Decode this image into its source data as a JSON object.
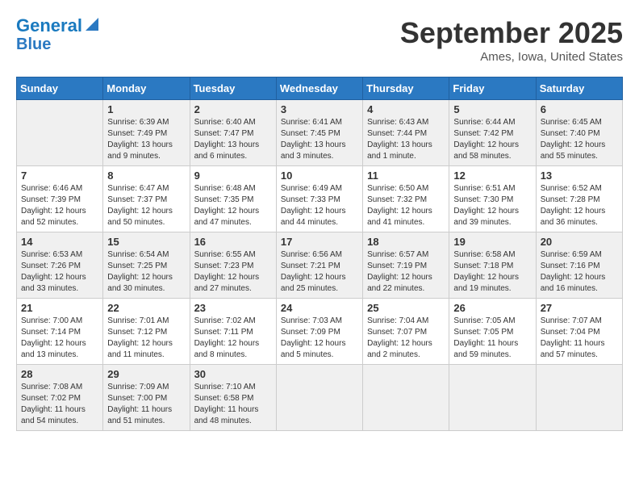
{
  "header": {
    "logo_line1": "General",
    "logo_line2": "Blue",
    "month_title": "September 2025",
    "location": "Ames, Iowa, United States"
  },
  "weekdays": [
    "Sunday",
    "Monday",
    "Tuesday",
    "Wednesday",
    "Thursday",
    "Friday",
    "Saturday"
  ],
  "weeks": [
    [
      {
        "day": "",
        "sunrise": "",
        "sunset": "",
        "daylight": ""
      },
      {
        "day": "1",
        "sunrise": "Sunrise: 6:39 AM",
        "sunset": "Sunset: 7:49 PM",
        "daylight": "Daylight: 13 hours and 9 minutes."
      },
      {
        "day": "2",
        "sunrise": "Sunrise: 6:40 AM",
        "sunset": "Sunset: 7:47 PM",
        "daylight": "Daylight: 13 hours and 6 minutes."
      },
      {
        "day": "3",
        "sunrise": "Sunrise: 6:41 AM",
        "sunset": "Sunset: 7:45 PM",
        "daylight": "Daylight: 13 hours and 3 minutes."
      },
      {
        "day": "4",
        "sunrise": "Sunrise: 6:43 AM",
        "sunset": "Sunset: 7:44 PM",
        "daylight": "Daylight: 13 hours and 1 minute."
      },
      {
        "day": "5",
        "sunrise": "Sunrise: 6:44 AM",
        "sunset": "Sunset: 7:42 PM",
        "daylight": "Daylight: 12 hours and 58 minutes."
      },
      {
        "day": "6",
        "sunrise": "Sunrise: 6:45 AM",
        "sunset": "Sunset: 7:40 PM",
        "daylight": "Daylight: 12 hours and 55 minutes."
      }
    ],
    [
      {
        "day": "7",
        "sunrise": "Sunrise: 6:46 AM",
        "sunset": "Sunset: 7:39 PM",
        "daylight": "Daylight: 12 hours and 52 minutes."
      },
      {
        "day": "8",
        "sunrise": "Sunrise: 6:47 AM",
        "sunset": "Sunset: 7:37 PM",
        "daylight": "Daylight: 12 hours and 50 minutes."
      },
      {
        "day": "9",
        "sunrise": "Sunrise: 6:48 AM",
        "sunset": "Sunset: 7:35 PM",
        "daylight": "Daylight: 12 hours and 47 minutes."
      },
      {
        "day": "10",
        "sunrise": "Sunrise: 6:49 AM",
        "sunset": "Sunset: 7:33 PM",
        "daylight": "Daylight: 12 hours and 44 minutes."
      },
      {
        "day": "11",
        "sunrise": "Sunrise: 6:50 AM",
        "sunset": "Sunset: 7:32 PM",
        "daylight": "Daylight: 12 hours and 41 minutes."
      },
      {
        "day": "12",
        "sunrise": "Sunrise: 6:51 AM",
        "sunset": "Sunset: 7:30 PM",
        "daylight": "Daylight: 12 hours and 39 minutes."
      },
      {
        "day": "13",
        "sunrise": "Sunrise: 6:52 AM",
        "sunset": "Sunset: 7:28 PM",
        "daylight": "Daylight: 12 hours and 36 minutes."
      }
    ],
    [
      {
        "day": "14",
        "sunrise": "Sunrise: 6:53 AM",
        "sunset": "Sunset: 7:26 PM",
        "daylight": "Daylight: 12 hours and 33 minutes."
      },
      {
        "day": "15",
        "sunrise": "Sunrise: 6:54 AM",
        "sunset": "Sunset: 7:25 PM",
        "daylight": "Daylight: 12 hours and 30 minutes."
      },
      {
        "day": "16",
        "sunrise": "Sunrise: 6:55 AM",
        "sunset": "Sunset: 7:23 PM",
        "daylight": "Daylight: 12 hours and 27 minutes."
      },
      {
        "day": "17",
        "sunrise": "Sunrise: 6:56 AM",
        "sunset": "Sunset: 7:21 PM",
        "daylight": "Daylight: 12 hours and 25 minutes."
      },
      {
        "day": "18",
        "sunrise": "Sunrise: 6:57 AM",
        "sunset": "Sunset: 7:19 PM",
        "daylight": "Daylight: 12 hours and 22 minutes."
      },
      {
        "day": "19",
        "sunrise": "Sunrise: 6:58 AM",
        "sunset": "Sunset: 7:18 PM",
        "daylight": "Daylight: 12 hours and 19 minutes."
      },
      {
        "day": "20",
        "sunrise": "Sunrise: 6:59 AM",
        "sunset": "Sunset: 7:16 PM",
        "daylight": "Daylight: 12 hours and 16 minutes."
      }
    ],
    [
      {
        "day": "21",
        "sunrise": "Sunrise: 7:00 AM",
        "sunset": "Sunset: 7:14 PM",
        "daylight": "Daylight: 12 hours and 13 minutes."
      },
      {
        "day": "22",
        "sunrise": "Sunrise: 7:01 AM",
        "sunset": "Sunset: 7:12 PM",
        "daylight": "Daylight: 12 hours and 11 minutes."
      },
      {
        "day": "23",
        "sunrise": "Sunrise: 7:02 AM",
        "sunset": "Sunset: 7:11 PM",
        "daylight": "Daylight: 12 hours and 8 minutes."
      },
      {
        "day": "24",
        "sunrise": "Sunrise: 7:03 AM",
        "sunset": "Sunset: 7:09 PM",
        "daylight": "Daylight: 12 hours and 5 minutes."
      },
      {
        "day": "25",
        "sunrise": "Sunrise: 7:04 AM",
        "sunset": "Sunset: 7:07 PM",
        "daylight": "Daylight: 12 hours and 2 minutes."
      },
      {
        "day": "26",
        "sunrise": "Sunrise: 7:05 AM",
        "sunset": "Sunset: 7:05 PM",
        "daylight": "Daylight: 11 hours and 59 minutes."
      },
      {
        "day": "27",
        "sunrise": "Sunrise: 7:07 AM",
        "sunset": "Sunset: 7:04 PM",
        "daylight": "Daylight: 11 hours and 57 minutes."
      }
    ],
    [
      {
        "day": "28",
        "sunrise": "Sunrise: 7:08 AM",
        "sunset": "Sunset: 7:02 PM",
        "daylight": "Daylight: 11 hours and 54 minutes."
      },
      {
        "day": "29",
        "sunrise": "Sunrise: 7:09 AM",
        "sunset": "Sunset: 7:00 PM",
        "daylight": "Daylight: 11 hours and 51 minutes."
      },
      {
        "day": "30",
        "sunrise": "Sunrise: 7:10 AM",
        "sunset": "Sunset: 6:58 PM",
        "daylight": "Daylight: 11 hours and 48 minutes."
      },
      {
        "day": "",
        "sunrise": "",
        "sunset": "",
        "daylight": ""
      },
      {
        "day": "",
        "sunrise": "",
        "sunset": "",
        "daylight": ""
      },
      {
        "day": "",
        "sunrise": "",
        "sunset": "",
        "daylight": ""
      },
      {
        "day": "",
        "sunrise": "",
        "sunset": "",
        "daylight": ""
      }
    ]
  ]
}
